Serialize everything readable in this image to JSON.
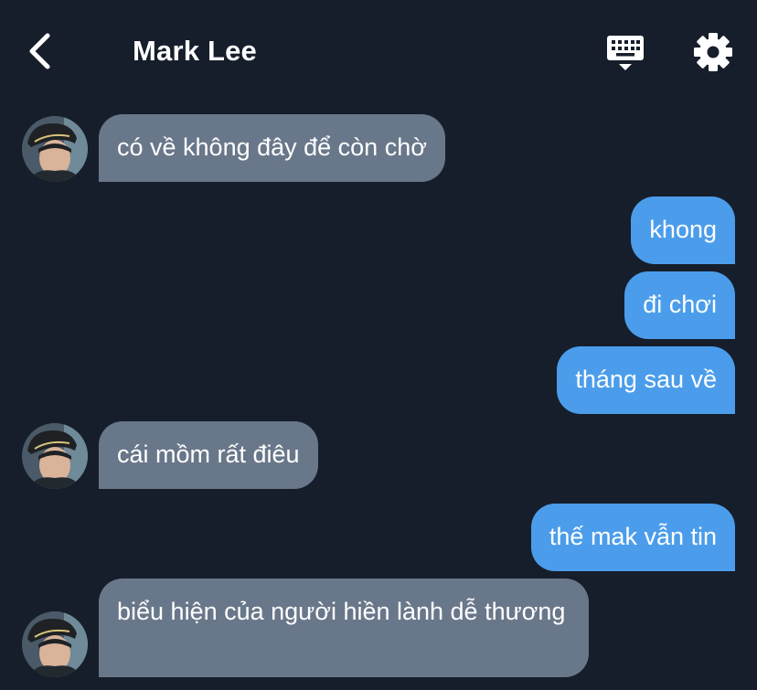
{
  "header": {
    "back_icon": "chevron-left-icon",
    "title": "Mark Lee",
    "keyboard_icon": "keyboard-hide-icon",
    "settings_icon": "gear-icon"
  },
  "colors": {
    "background": "#161e2b",
    "incoming_bubble": "#69778a",
    "outgoing_bubble": "#4b9deb",
    "text": "#ffffff"
  },
  "messages": [
    {
      "direction": "incoming",
      "text": "có về không đây để còn chờ",
      "avatar": "contact-avatar"
    },
    {
      "direction": "outgoing",
      "text": "khong"
    },
    {
      "direction": "outgoing",
      "text": "đi chơi"
    },
    {
      "direction": "outgoing",
      "text": "tháng sau về"
    },
    {
      "direction": "incoming",
      "text": "cái mồm rất điêu",
      "avatar": "contact-avatar"
    },
    {
      "direction": "outgoing",
      "text": "thế mak vẫn tin"
    },
    {
      "direction": "incoming",
      "text": "biểu hiện của người hiền lành dễ thương",
      "avatar": "contact-avatar"
    }
  ]
}
